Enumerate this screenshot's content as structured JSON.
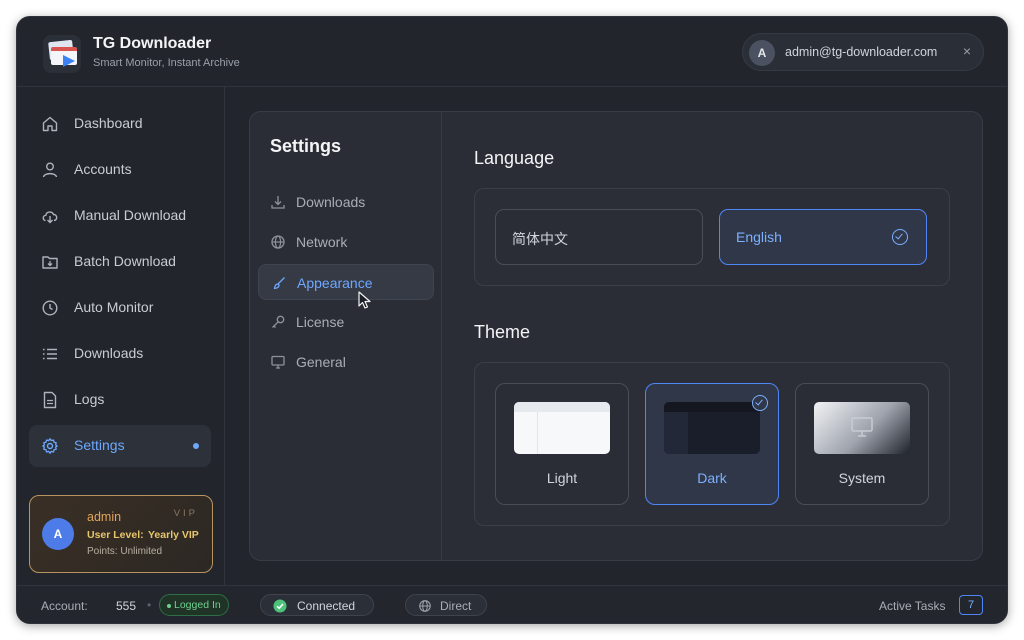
{
  "app": {
    "title": "TG Downloader",
    "subtitle": "Smart Monitor, Instant Archive"
  },
  "header": {
    "user_avatar": "A",
    "user_email": "admin@tg-downloader.com",
    "close_glyph": "×"
  },
  "sidebar": {
    "items": [
      {
        "label": "Dashboard",
        "icon": "home-icon"
      },
      {
        "label": "Accounts",
        "icon": "user-icon"
      },
      {
        "label": "Manual Download",
        "icon": "cloud-download-icon"
      },
      {
        "label": "Batch Download",
        "icon": "folder-download-icon"
      },
      {
        "label": "Auto Monitor",
        "icon": "clock-icon"
      },
      {
        "label": "Downloads",
        "icon": "list-icon"
      },
      {
        "label": "Logs",
        "icon": "file-icon"
      },
      {
        "label": "Settings",
        "icon": "gear-icon",
        "active": true
      }
    ]
  },
  "user_card": {
    "avatar": "A",
    "name": "admin",
    "badge": "VIP",
    "level_label": "User Level:",
    "level_value": "Yearly VIP",
    "points": "Points: Unlimited"
  },
  "settings": {
    "title": "Settings",
    "nav": [
      {
        "label": "Downloads",
        "icon": "download-icon"
      },
      {
        "label": "Network",
        "icon": "globe-icon"
      },
      {
        "label": "Appearance",
        "icon": "brush-icon",
        "active": true
      },
      {
        "label": "License",
        "icon": "key-icon"
      },
      {
        "label": "General",
        "icon": "monitor-icon"
      }
    ],
    "language": {
      "title": "Language",
      "options": [
        "简体中文",
        "English"
      ],
      "selected": "English"
    },
    "theme": {
      "title": "Theme",
      "options": [
        "Light",
        "Dark",
        "System"
      ],
      "selected": "Dark"
    }
  },
  "statusbar": {
    "account_label": "Account:",
    "account_count": "555",
    "logged_in": "Logged In",
    "connection": "Connected",
    "proxy": "Direct",
    "active_tasks_label": "Active Tasks",
    "active_tasks_count": "7"
  },
  "colors": {
    "accent": "#4f86f7",
    "accent_text": "#6ea8fe",
    "vip_gold": "#e7c66b",
    "success": "#4ec27a"
  }
}
